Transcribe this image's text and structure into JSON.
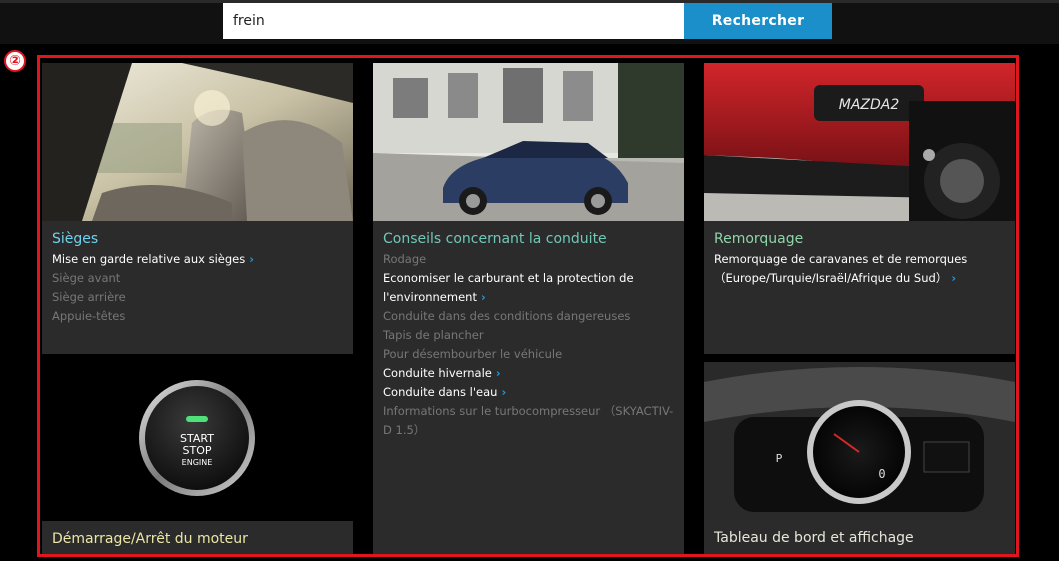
{
  "search": {
    "value": "frein",
    "button_label": "Rechercher"
  },
  "marker_label": "②",
  "cards": {
    "sieges": {
      "title": "Sièges",
      "title_color": "#6fd3ef",
      "links": [
        {
          "label": "Mise en garde relative aux sièges",
          "active": true
        },
        {
          "label": "Siège avant",
          "active": false
        },
        {
          "label": "Siège arrière",
          "active": false
        },
        {
          "label": "Appuie-têtes",
          "active": false
        }
      ]
    },
    "start": {
      "title": "Démarrage/Arrêt du moteur",
      "title_color": "#ece6a8",
      "button_text": [
        "START",
        "STOP",
        "ENGINE"
      ]
    },
    "conseils": {
      "title": "Conseils concernant la conduite",
      "title_color": "#70c8b6",
      "links": [
        {
          "label": "Rodage",
          "active": false
        },
        {
          "label": "Economiser le carburant et la protection de l'environnement",
          "active": true
        },
        {
          "label": "Conduite dans des conditions dangereuses",
          "active": false
        },
        {
          "label": "Tapis de plancher",
          "active": false
        },
        {
          "label": "Pour désembourber le véhicule",
          "active": false
        },
        {
          "label": "Conduite hivernale",
          "active": true
        },
        {
          "label": "Conduite dans l'eau",
          "active": true
        },
        {
          "label": "Informations sur le turbocompresseur （SKYACTIV-D 1.5）",
          "active": false
        }
      ]
    },
    "remorquage": {
      "title": "Remorquage",
      "title_color": "#8fd6a9",
      "car_badge": "MAZDA2",
      "links": [
        {
          "label": "Remorquage de caravanes et de remorques （Europe/Turquie/Israël/Afrique du Sud）",
          "active": true
        }
      ]
    },
    "tableau": {
      "title": "Tableau de bord et affichage",
      "title_color": "#e8e6da"
    }
  },
  "colors": {
    "accent": "#1a8fc9",
    "highlight": "#e0161e",
    "chevron": "#1f9be0"
  }
}
